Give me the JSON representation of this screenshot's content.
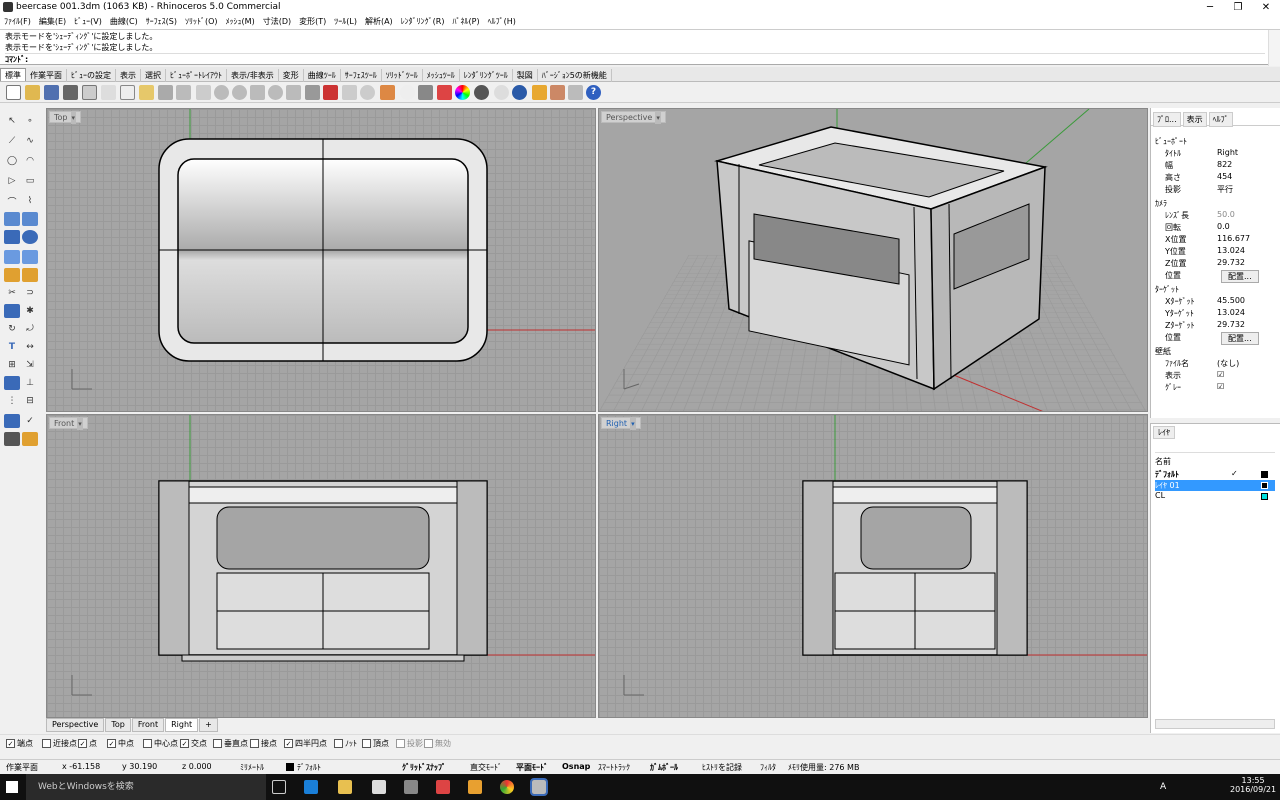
{
  "window": {
    "title": "beercase 001.3dm (1063 KB) - Rhinoceros 5.0 Commercial",
    "controls": [
      "─",
      "❐",
      "✕"
    ]
  },
  "menu": [
    "ﾌｧｲﾙ(F)",
    "編集(E)",
    "ﾋﾞｭｰ(V)",
    "曲線(C)",
    "ｻｰﾌｪｽ(S)",
    "ｿﾘｯﾄﾞ(O)",
    "ﾒｯｼｭ(M)",
    "寸法(D)",
    "変形(T)",
    "ﾂｰﾙ(L)",
    "解析(A)",
    "ﾚﾝﾀﾞﾘﾝｸﾞ(R)",
    "ﾊﾟﾈﾙ(P)",
    "ﾍﾙﾌﾟ(H)"
  ],
  "command": {
    "history": [
      "表示モードを'ｼｪｰﾃﾞｨﾝｸﾞ'に設定しました。",
      "表示モードを'ｼｪｰﾃﾞｨﾝｸﾞ'に設定しました。"
    ],
    "prompt": "ｺﾏﾝﾄﾞ:"
  },
  "tabs": [
    "標準",
    "作業平面",
    "ﾋﾞｭｰの設定",
    "表示",
    "選択",
    "ﾋﾞｭｰﾎﾟｰﾄﾚｲｱｳﾄ",
    "表示/非表示",
    "変形",
    "曲線ﾂｰﾙ",
    "ｻｰﾌｪｽﾂｰﾙ",
    "ｿﾘｯﾄﾞﾂｰﾙ",
    "ﾒｯｼｭﾂｰﾙ",
    "ﾚﾝﾀﾞﾘﾝｸﾞﾂｰﾙ",
    "製図",
    "ﾊﾞｰｼﾞｮﾝ5の新機能"
  ],
  "viewports": {
    "top": "Top",
    "perspective": "Perspective",
    "front": "Front",
    "right": "Right"
  },
  "viewport_tabs": [
    "Perspective",
    "Top",
    "Front",
    "Right",
    "+"
  ],
  "properties": {
    "tabs": [
      "ﾌﾟﾛ...",
      "表示",
      "ﾍﾙﾌﾟ"
    ],
    "viewport_section": "ﾋﾞｭｰﾎﾟｰﾄ",
    "rows": [
      {
        "k": "ﾀｲﾄﾙ",
        "v": "Right"
      },
      {
        "k": "幅",
        "v": "822"
      },
      {
        "k": "高さ",
        "v": "454"
      },
      {
        "k": "投影",
        "v": "平行"
      }
    ],
    "camera_section": "ｶﾒﾗ",
    "camera": [
      {
        "k": "ﾚﾝｽﾞ長",
        "v": "50.0"
      },
      {
        "k": "回転",
        "v": "0.0"
      },
      {
        "k": "X位置",
        "v": "116.677"
      },
      {
        "k": "Y位置",
        "v": "13.024"
      },
      {
        "k": "Z位置",
        "v": "29.732"
      },
      {
        "k": "位置",
        "v": "配置..."
      }
    ],
    "target_section": "ﾀｰｹﾞｯﾄ",
    "target": [
      {
        "k": "Xﾀｰｹﾞｯﾄ",
        "v": "45.500"
      },
      {
        "k": "Yﾀｰｹﾞｯﾄ",
        "v": "13.024"
      },
      {
        "k": "Zﾀｰｹﾞｯﾄ",
        "v": "29.732"
      },
      {
        "k": "位置",
        "v": "配置..."
      }
    ],
    "wallpaper_section": "壁紙",
    "wallpaper": [
      {
        "k": "ﾌｧｲﾙ名",
        "v": "(なし)"
      },
      {
        "k": "表示",
        "v": "☑"
      },
      {
        "k": "ｸﾞﾚｰ",
        "v": "☑"
      }
    ]
  },
  "layers": {
    "tab": "ﾚｲﾔ",
    "header": "名前",
    "rows": [
      {
        "name": "ﾃﾞﾌｫﾙﾄ",
        "check": "✓",
        "color": "#000000"
      },
      {
        "name": "ﾚｲﾔ 01",
        "check": "",
        "color": "#000000"
      },
      {
        "name": "CL",
        "check": "",
        "color": "#00e0e0"
      }
    ]
  },
  "osnap": [
    {
      "label": "端点",
      "on": true
    },
    {
      "label": "近接点",
      "on": false
    },
    {
      "label": "点",
      "on": true
    },
    {
      "label": "中点",
      "on": true
    },
    {
      "label": "中心点",
      "on": false
    },
    {
      "label": "交点",
      "on": true
    },
    {
      "label": "垂直点",
      "on": false
    },
    {
      "label": "接点",
      "on": false
    },
    {
      "label": "四半円点",
      "on": true
    },
    {
      "label": "ﾉｯﾄ",
      "on": false
    },
    {
      "label": "頂点",
      "on": false
    },
    {
      "label": "投影",
      "on": false
    },
    {
      "label": "無効",
      "on": false
    }
  ],
  "status": {
    "plane": "作業平面",
    "x": "x -61.158",
    "y": "y 30.190",
    "z": "z 0.000",
    "unit": "ﾐﾘﾒｰﾄﾙ",
    "layer": "ﾃﾞﾌｫﾙﾄ",
    "grid_snap": "ｸﾞﾘｯﾄﾞｽﾅｯﾌﾟ",
    "ortho": "直交ﾓｰﾄﾞ",
    "planar": "平面ﾓｰﾄﾞ",
    "osnap": "Osnap",
    "smarttrack": "ｽﾏｰﾄﾄﾗｯｸ",
    "gumball": "ｶﾞﾑﾎﾞｰﾙ",
    "history": "ﾋｽﾄﾘを記録",
    "filter": "ﾌｨﾙﾀ",
    "memory": "ﾒﾓﾘ使用量: 276 MB"
  },
  "taskbar": {
    "search": "WebとWindowsを検索",
    "time": "13:55",
    "date": "2016/09/21",
    "lang": "A"
  }
}
